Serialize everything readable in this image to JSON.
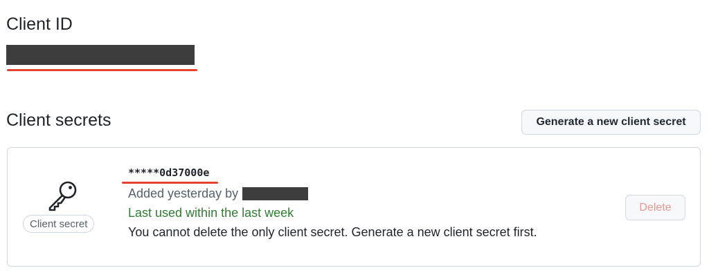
{
  "client_id": {
    "heading": "Client ID"
  },
  "client_secrets": {
    "heading": "Client secrets",
    "generate_button_label": "Generate a new client secret",
    "items": [
      {
        "badge_label": "Client secret",
        "icon": "key-icon",
        "masked_value": "*****0d37000e",
        "added_text": "Added yesterday by",
        "last_used_text": "Last used within the last week",
        "note": "You cannot delete the only client secret. Generate a new client secret first.",
        "delete_label": "Delete",
        "delete_disabled": true
      }
    ]
  },
  "colors": {
    "accent_underline": "#e5412f",
    "last_used_green": "#2f7d32",
    "redaction": "#3d3d3d",
    "disabled_delete_text": "#e89593"
  }
}
